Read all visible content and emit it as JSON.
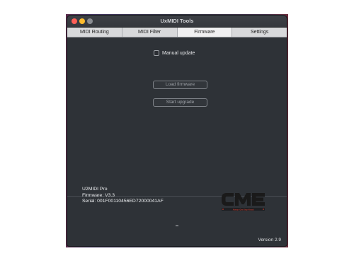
{
  "window": {
    "title": "UxMIDI Tools"
  },
  "tabs": [
    {
      "label": "MIDI Routing",
      "active": false
    },
    {
      "label": "MIDI Filter",
      "active": false
    },
    {
      "label": "Firmware",
      "active": true
    },
    {
      "label": "Settings",
      "active": false
    }
  ],
  "firmware": {
    "manual_update_label": "Manual update",
    "manual_update_checked": false,
    "load_button": "Load firmware",
    "start_button": "Start upgrade"
  },
  "device": {
    "name": "U2MIDI Pro",
    "firmware": "Firmware: V3.3",
    "serial": "Serial: 001F00110456ED72000041AF"
  },
  "logo": {
    "text": "CME",
    "tagline": "Always  One  Step  Ahead",
    "color": "#1a1a1a",
    "accent": "#c0392b"
  },
  "footer": {
    "version": "Version 2.9"
  },
  "colors": {
    "close": "#fe5f57",
    "minimize": "#febc2e",
    "maximize": "#8a8d92",
    "window_bg": "#2e3237"
  }
}
